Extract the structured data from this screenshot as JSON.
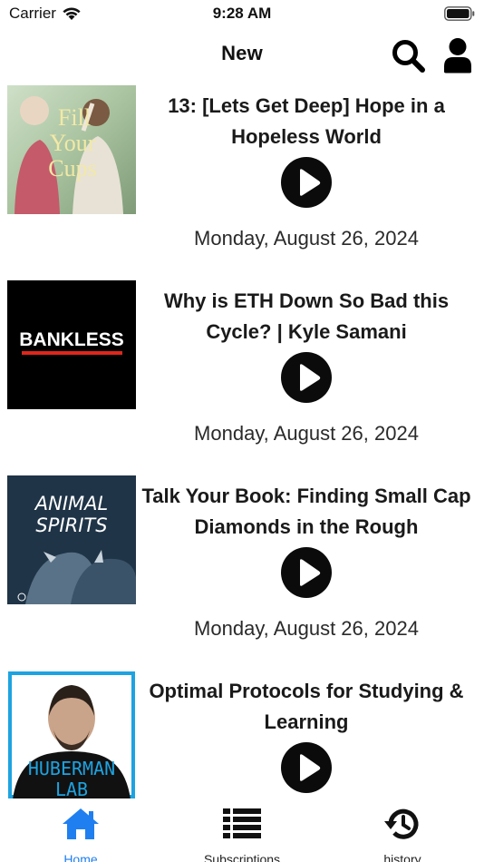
{
  "status_bar": {
    "carrier": "Carrier",
    "time": "9:28 AM"
  },
  "nav": {
    "title": "New"
  },
  "episodes": [
    {
      "title": "13: [Lets Get Deep] Hope in a Hopeless World",
      "date": "Monday, August 26, 2024",
      "artwork_text": "Fill Your Cups"
    },
    {
      "title": "Why is ETH Down So Bad this Cycle? | Kyle Samani",
      "date": "Monday, August 26, 2024",
      "artwork_text": "BANKLESS"
    },
    {
      "title": "Talk Your Book: Finding Small Cap Diamonds in the Rough",
      "date": "Monday, August 26, 2024",
      "artwork_text": "ANIMAL SPIRITS"
    },
    {
      "title": "Optimal Protocols for Studying & Learning",
      "date": "",
      "artwork_text": "HUBERMAN LAB"
    }
  ],
  "tabbar": {
    "home": "Home",
    "subscriptions": "Subscriptions",
    "history": "history"
  },
  "colors": {
    "accent": "#1f7ff0",
    "play_button": "#0b0b0b",
    "bankless_red": "#e0261b"
  },
  "icons": {
    "search": "search-icon",
    "user": "user-icon",
    "play": "play-icon",
    "home": "home-icon",
    "subscriptions": "list-icon",
    "history": "history-icon"
  }
}
